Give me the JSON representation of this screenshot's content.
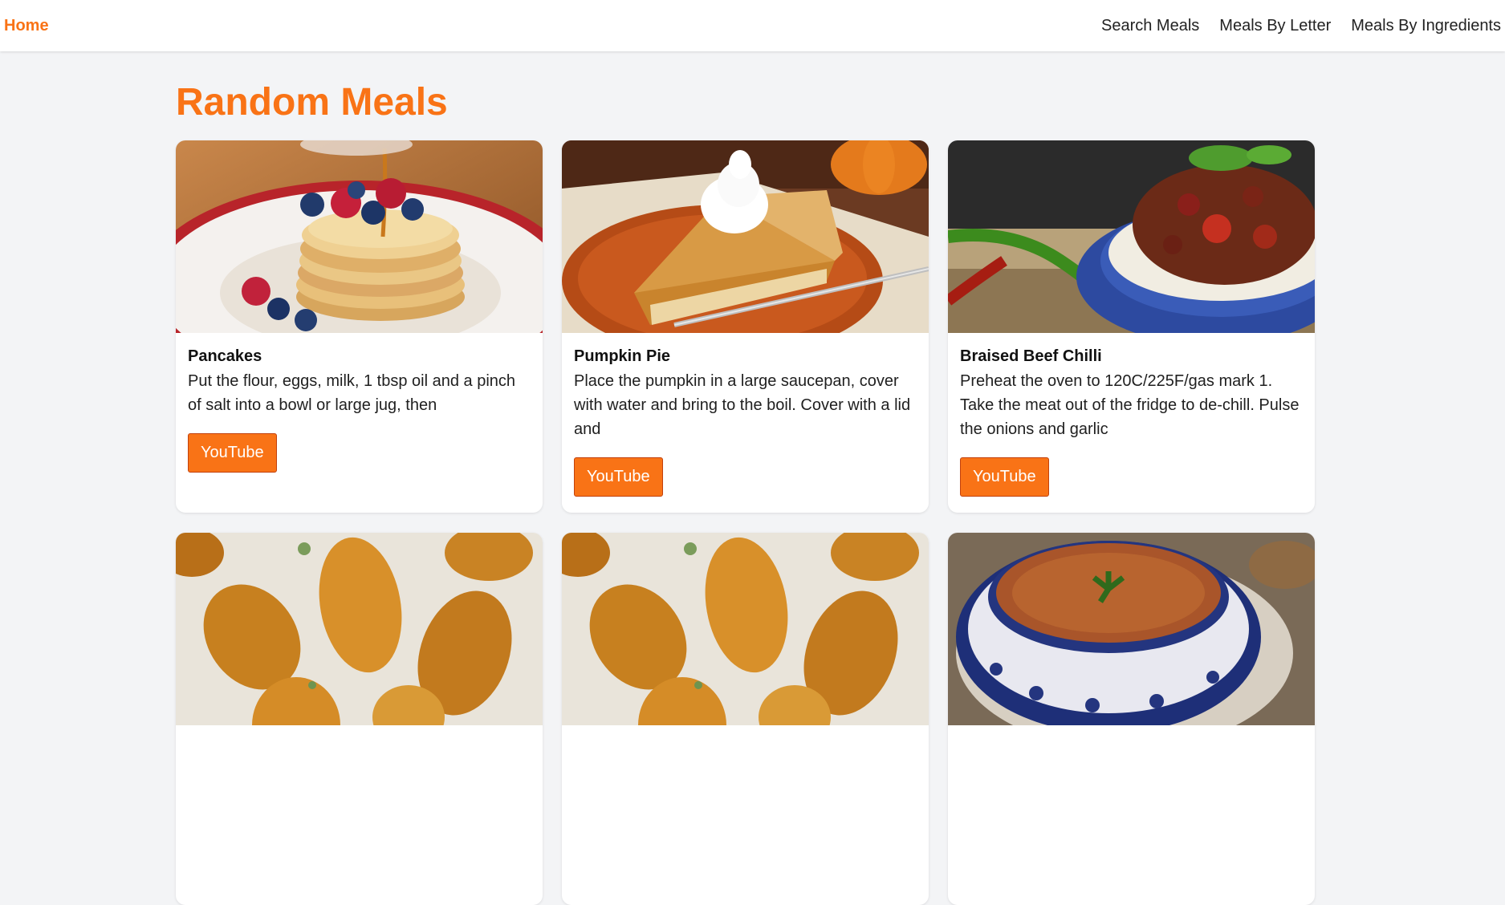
{
  "nav": {
    "home": "Home",
    "links": [
      "Search Meals",
      "Meals By Letter",
      "Meals By Ingredients"
    ]
  },
  "page_title": "Random Meals",
  "meals": [
    {
      "title": "Pancakes",
      "desc": "Put the flour, eggs, milk, 1 tbsp oil and a pinch of salt into a bowl or large jug, then",
      "button": "YouTube"
    },
    {
      "title": "Pumpkin Pie",
      "desc": "Place the pumpkin in a large saucepan, cover with water and bring to the boil. Cover with a lid and",
      "button": "YouTube"
    },
    {
      "title": "Braised Beef Chilli",
      "desc": "Preheat the oven to 120C/225F/gas mark 1. Take the meat out of the fridge to de-chill. Pulse the onions and garlic",
      "button": "YouTube"
    },
    {
      "title": "",
      "desc": "",
      "button": ""
    },
    {
      "title": "",
      "desc": "",
      "button": ""
    },
    {
      "title": "",
      "desc": "",
      "button": ""
    }
  ],
  "colors": {
    "accent": "#f97316",
    "background": "#f3f4f6"
  }
}
